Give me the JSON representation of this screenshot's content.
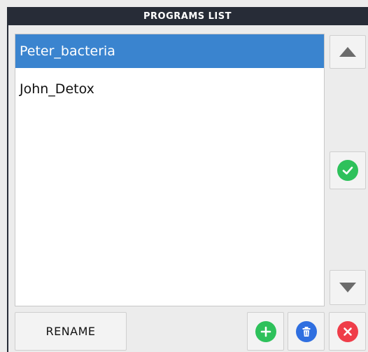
{
  "window": {
    "title": "PROGRAMS LIST"
  },
  "programs": [
    {
      "name": "Peter_bacteria",
      "selected": true
    },
    {
      "name": "John_Detox",
      "selected": false
    }
  ],
  "controls": {
    "rename_label": "RENAME",
    "scroll_up_icon": "triangle-up-icon",
    "scroll_down_icon": "triangle-down-icon",
    "confirm_icon": "checkmark-icon",
    "add_icon": "plus-icon",
    "delete_icon": "trash-icon",
    "close_icon": "x-icon"
  },
  "colors": {
    "titlebar": "#272c37",
    "selected_row": "#3a84cf",
    "confirm": "#2ec15b",
    "add": "#2ec15b",
    "delete": "#2f6fe0",
    "close": "#ef3d49"
  }
}
